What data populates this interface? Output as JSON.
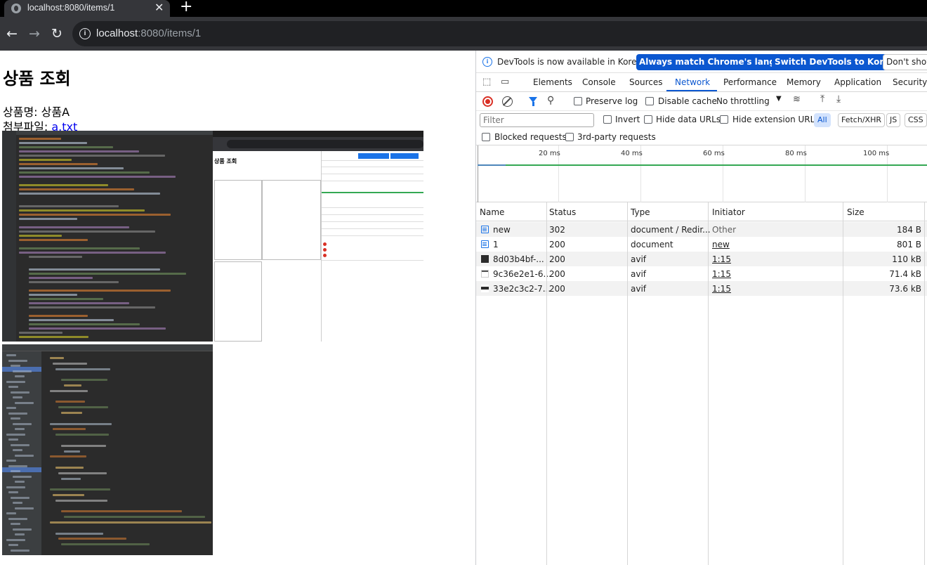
{
  "browser": {
    "tab_title": "localhost:8080/items/1",
    "url_host": "localhost",
    "url_rest": ":8080/items/1",
    "close_glyph": "✕",
    "newtab_glyph": "+"
  },
  "page": {
    "heading": "상품 조회",
    "product_label": "상품명: 상품A",
    "attach_label": "첨부파일: ",
    "attach_link": "a.txt"
  },
  "devtools": {
    "infobar": {
      "message": "DevTools is now available in Korean!",
      "btn_match": "Always match Chrome's language",
      "btn_switch": "Switch DevTools to Korean",
      "btn_dont": "Don't show"
    },
    "tabs": [
      "Elements",
      "Console",
      "Sources",
      "Network",
      "Performance",
      "Memory",
      "Application",
      "Security"
    ],
    "active_tab": "Network",
    "toolbar": {
      "preserve_log": "Preserve log",
      "disable_cache": "Disable cache",
      "throttling": "No throttling"
    },
    "filter": {
      "placeholder": "Filter",
      "invert": "Invert",
      "hide_data": "Hide data URLs",
      "hide_ext": "Hide extension URLs",
      "chips": [
        "All",
        "Fetch/XHR",
        "JS",
        "CSS"
      ]
    },
    "blocked": {
      "blocked_requests": "Blocked requests",
      "third_party": "3rd-party requests"
    },
    "overview_ticks": [
      "20 ms",
      "40 ms",
      "60 ms",
      "80 ms",
      "100 ms"
    ],
    "columns": [
      "Name",
      "Status",
      "Type",
      "Initiator",
      "Size"
    ],
    "rows": [
      {
        "name": "new",
        "status": "302",
        "type": "document / Redir...",
        "initiator": "Other",
        "size": "184 B",
        "icon": "document-icon"
      },
      {
        "name": "1",
        "status": "200",
        "type": "document",
        "initiator": "new",
        "size": "801 B",
        "icon": "document-icon"
      },
      {
        "name": "8d03b4bf-...",
        "status": "200",
        "type": "avif",
        "initiator": "1:15",
        "size": "110 kB",
        "icon": "image-icon"
      },
      {
        "name": "9c36e2e1-6...",
        "status": "200",
        "type": "avif",
        "initiator": "1:15",
        "size": "71.4 kB",
        "icon": "image-icon"
      },
      {
        "name": "33e2c3c2-7...",
        "status": "200",
        "type": "avif",
        "initiator": "1:15",
        "size": "73.6 kB",
        "icon": "image-icon"
      }
    ]
  },
  "colors": {
    "accent": "#0b57d0",
    "chrome_dark": "#35363a",
    "record_red": "#d93025"
  }
}
